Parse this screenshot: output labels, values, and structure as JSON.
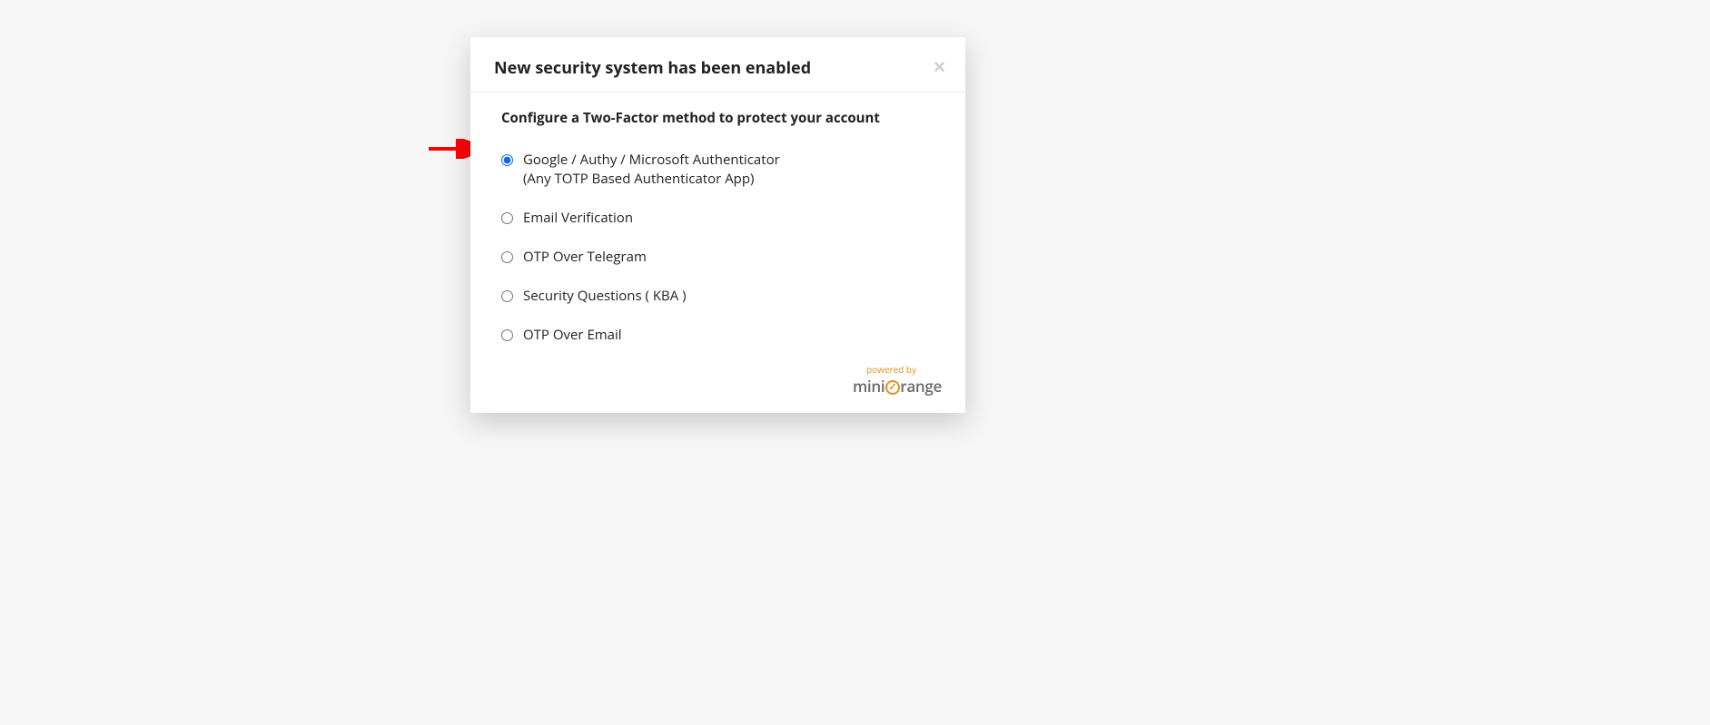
{
  "modal": {
    "title": "New security system has been enabled",
    "subtitle": "Configure a Two-Factor method to protect your account",
    "options": [
      {
        "label": "Google / Authy / Microsoft Authenticator",
        "sub": "(Any TOTP Based Authenticator App)",
        "selected": true
      },
      {
        "label": "Email Verification",
        "sub": "",
        "selected": false
      },
      {
        "label": "OTP Over Telegram",
        "sub": "",
        "selected": false
      },
      {
        "label": "Security Questions ( KBA )",
        "sub": "",
        "selected": false
      },
      {
        "label": "OTP Over Email",
        "sub": "",
        "selected": false
      }
    ],
    "footer": {
      "powered": "powered by",
      "brand_prefix": "mini",
      "brand_suffix": "range"
    }
  }
}
